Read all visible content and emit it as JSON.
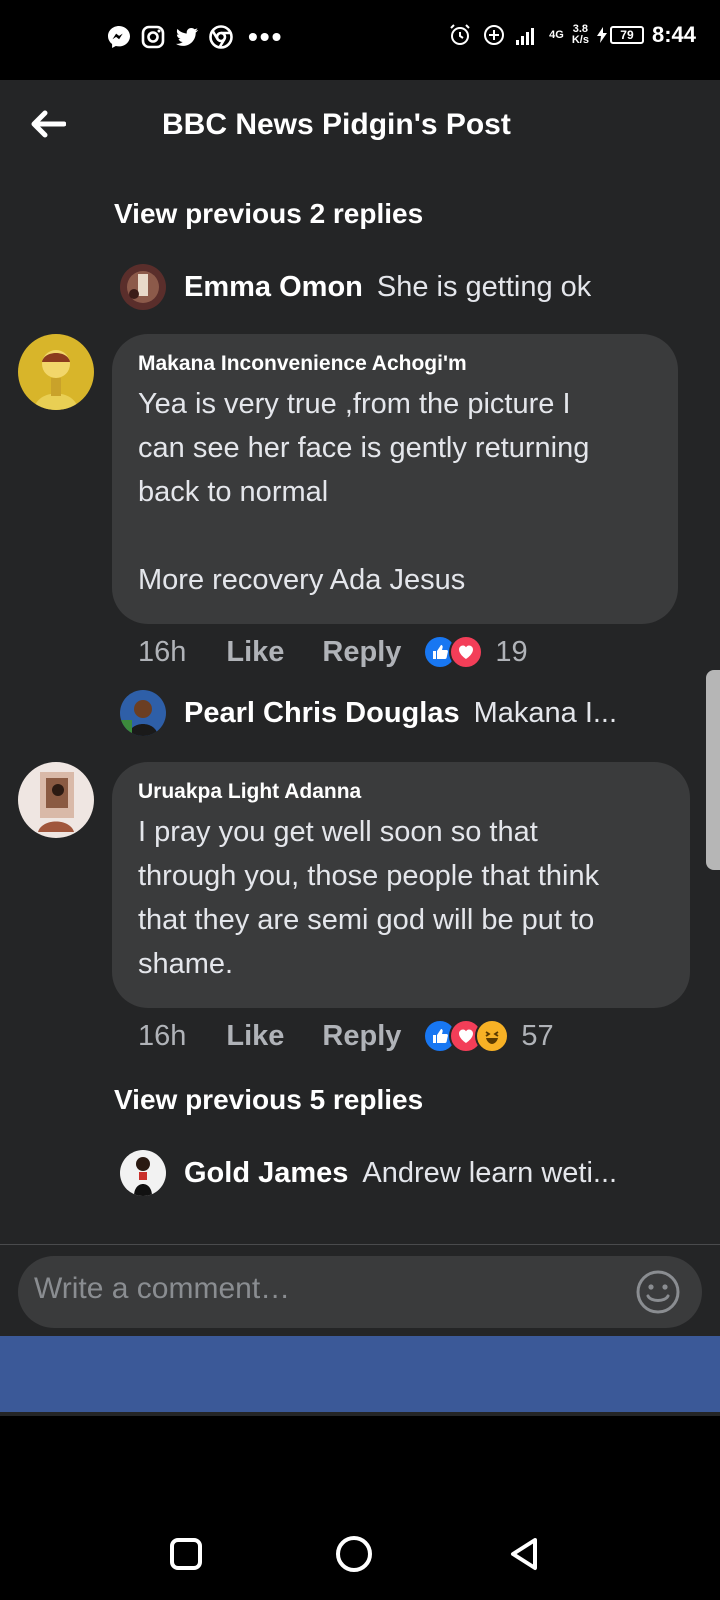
{
  "status_bar": {
    "network_label": "4G",
    "speed_value": "3.8",
    "speed_unit": "K/s",
    "battery": "79",
    "time": "8:44"
  },
  "header": {
    "title": "BBC News Pidgin's Post"
  },
  "thread": {
    "view_previous_1": "View previous 2 replies",
    "reply_1": {
      "name": "Emma Omon",
      "text": "She is getting ok"
    },
    "comment_1": {
      "name": "Makana Inconvenience Achogi'm",
      "text": "Yea is very true ,from the picture I\ncan see her face is gently returning\nback to normal\n\nMore recovery Ada Jesus",
      "time": "16h",
      "like": "Like",
      "reply": "Reply",
      "reactions": [
        "like",
        "love"
      ],
      "reaction_count": "19"
    },
    "reply_2": {
      "name": "Pearl Chris Douglas",
      "text": "Makana I..."
    },
    "comment_2": {
      "name": "Uruakpa Light Adanna",
      "text": "I pray you get well soon so that\nthrough you, those people that think\nthat they are semi god will be put to\nshame.",
      "time": "16h",
      "like": "Like",
      "reply": "Reply",
      "reactions": [
        "like",
        "love",
        "haha"
      ],
      "reaction_count": "57"
    },
    "view_previous_2": "View previous 5 replies",
    "reply_3": {
      "name": "Gold James",
      "text": "Andrew learn weti..."
    }
  },
  "composer": {
    "placeholder": "Write a comment…"
  },
  "icons": {
    "status_left": [
      "messenger-icon",
      "instagram-icon",
      "twitter-icon",
      "chrome-icon",
      "more-dots-icon"
    ],
    "status_right": [
      "alarm-icon",
      "data-saver-icon",
      "signal-icon",
      "battery-icon"
    ],
    "nav": [
      "recents-square-icon",
      "home-circle-icon",
      "back-triangle-icon"
    ]
  },
  "colors": {
    "background": "#242526",
    "bubble": "#3a3b3c",
    "accent_blue": "#3b5998",
    "like_blue": "#1877f2",
    "love_red": "#f33e58"
  }
}
